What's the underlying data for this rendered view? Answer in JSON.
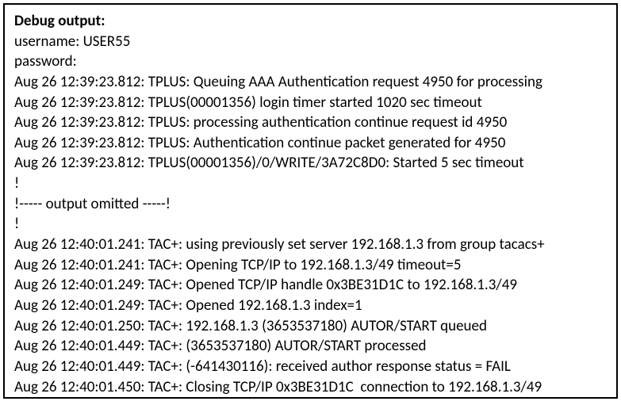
{
  "header": "Debug output:",
  "username_label": "username: ",
  "username_value": "USER55",
  "password_label": "password:",
  "lines": [
    "Aug 26 12:39:23.812: TPLUS: Queuing AAA Authentication request 4950 for processing",
    "Aug 26 12:39:23.812: TPLUS(00001356) login timer started 1020 sec timeout",
    "Aug 26 12:39:23.812: TPLUS: processing authentication continue request id 4950",
    "Aug 26 12:39:23.812: TPLUS: Authentication continue packet generated for 4950",
    "Aug 26 12:39:23.812: TPLUS(00001356)/0/WRITE/3A72C8D0: Started 5 sec timeout",
    "!",
    "!----- output omitted -----!",
    "!",
    "Aug 26 12:40:01.241: TAC+: using previously set server 192.168.1.3 from group tacacs+",
    "Aug 26 12:40:01.241: TAC+: Opening TCP/IP to 192.168.1.3/49 timeout=5",
    "Aug 26 12:40:01.249: TAC+: Opened TCP/IP handle 0x3BE31D1C to 192.168.1.3/49",
    "Aug 26 12:40:01.249: TAC+: Opened 192.168.1.3 index=1",
    "Aug 26 12:40:01.250: TAC+: 192.168.1.3 (3653537180) AUTOR/START queued",
    "Aug 26 12:40:01.449: TAC+: (3653537180) AUTOR/START processed",
    "Aug 26 12:40:01.449: TAC+: (-641430116): received author response status = FAIL",
    "Aug 26 12:40:01.450: TAC+: Closing TCP/IP 0x3BE31D1C  connection to 192.168.1.3/49"
  ]
}
